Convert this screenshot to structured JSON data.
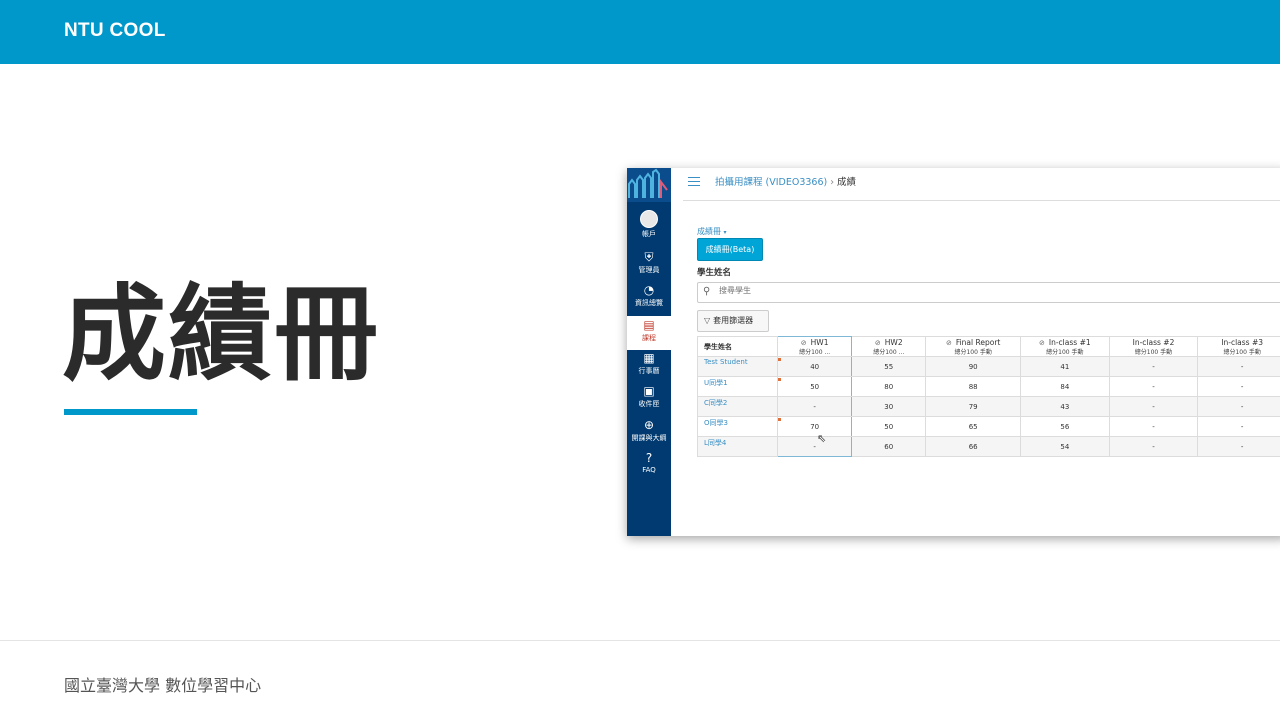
{
  "slide": {
    "brand": "NTU COOL",
    "title": "成績冊",
    "footer": "國立臺灣大學 數位學習中心",
    "accent_color": "#0098cb"
  },
  "nav": {
    "items": [
      {
        "label": "帳戶",
        "icon": "account-icon"
      },
      {
        "label": "管理員",
        "icon": "admin-shield-icon"
      },
      {
        "label": "資訊總覽",
        "icon": "dashboard-icon"
      },
      {
        "label": "課程",
        "icon": "courses-icon",
        "active": true
      },
      {
        "label": "行事曆",
        "icon": "calendar-icon"
      },
      {
        "label": "收件匣",
        "icon": "inbox-icon"
      },
      {
        "label": "開課與大綱",
        "icon": "plus-circle-icon"
      },
      {
        "label": "FAQ",
        "icon": "help-icon"
      }
    ]
  },
  "header": {
    "course": "拍攝用課程 (VIDEO3366)",
    "separator": "›",
    "current": "成績"
  },
  "gradebook": {
    "menu_label": "成績冊",
    "menu_caret": "▾",
    "beta_button": "成績冊(Beta)",
    "student_name_label": "學生姓名",
    "search_placeholder": "搜尋學生",
    "filter_button": "套用篩選器"
  },
  "table": {
    "student_header": "學生姓名",
    "columns": [
      {
        "name": "HW1",
        "sub": "總分100 ..."
      },
      {
        "name": "HW2",
        "sub": "總分100 ..."
      },
      {
        "name": "Final Report",
        "sub": "總分100 手動"
      },
      {
        "name": "In-class #1",
        "sub": "總分100 手動"
      },
      {
        "name": "In-class #2",
        "sub": "總分100 手動"
      },
      {
        "name": "In-class #3",
        "sub": "總分100 手動"
      }
    ],
    "rows": [
      {
        "student": "Test Student",
        "scores": [
          "40",
          "55",
          "90",
          "41",
          "-",
          "-"
        ]
      },
      {
        "student": "U同學1",
        "scores": [
          "50",
          "80",
          "88",
          "84",
          "-",
          "-"
        ]
      },
      {
        "student": "C同學2",
        "scores": [
          "-",
          "30",
          "79",
          "43",
          "-",
          "-"
        ]
      },
      {
        "student": "O同學3",
        "scores": [
          "70",
          "50",
          "65",
          "56",
          "-",
          "-"
        ]
      },
      {
        "student": "L同學4",
        "scores": [
          "-",
          "60",
          "66",
          "54",
          "-",
          "-"
        ]
      }
    ]
  }
}
